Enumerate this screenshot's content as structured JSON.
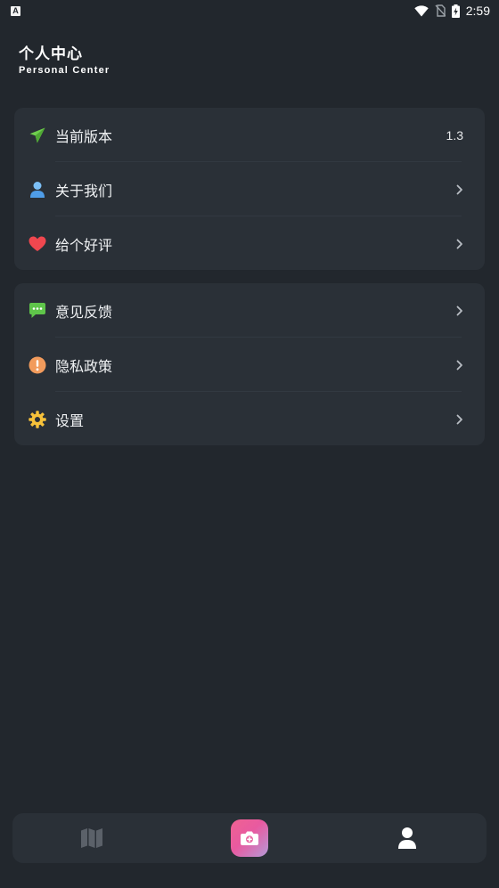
{
  "status_bar": {
    "left_badge": "A",
    "time": "2:59"
  },
  "header": {
    "title": "个人中心",
    "subtitle": "Personal Center"
  },
  "sections": [
    {
      "items": [
        {
          "label": "当前版本",
          "value": "1.3",
          "icon": "paper-plane-icon"
        },
        {
          "label": "关于我们",
          "icon": "user-icon"
        },
        {
          "label": "给个好评",
          "icon": "heart-icon"
        }
      ]
    },
    {
      "items": [
        {
          "label": "意见反馈",
          "icon": "chat-bubble-icon"
        },
        {
          "label": "隐私政策",
          "icon": "exclamation-icon"
        },
        {
          "label": "设置",
          "icon": "gear-icon"
        }
      ]
    }
  ],
  "tabbar": {
    "tabs": [
      {
        "icon": "map-icon",
        "active": false
      },
      {
        "icon": "camera-icon",
        "active": false
      },
      {
        "icon": "profile-icon",
        "active": true
      }
    ]
  },
  "colors": {
    "background": "#22272d",
    "card": "#2a3037",
    "plane_green": "#6fcf4e",
    "user_blue": "#5aa9f0",
    "heart_red": "#f0474f",
    "chat_green": "#5fc54a",
    "warning_orange": "#f29b5c",
    "gear_yellow": "#f7c23a",
    "camera_gradient_start": "#f06292",
    "camera_gradient_end": "#b59ad8"
  }
}
